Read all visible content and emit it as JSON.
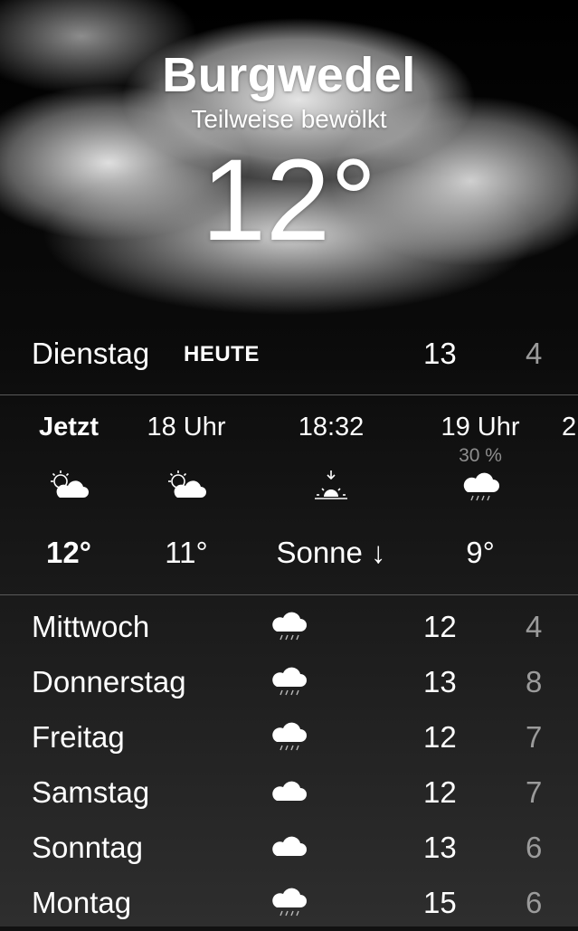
{
  "location": {
    "city": "Burgwedel",
    "condition": "Teilweise bewölkt",
    "temperature": "12°"
  },
  "today": {
    "day": "Dienstag",
    "tag": "HEUTE",
    "high": "13",
    "low": "4"
  },
  "hourly": [
    {
      "time": "Jetzt",
      "pop": "",
      "icon": "partly-cloudy-icon",
      "temp": "12°"
    },
    {
      "time": "18 Uhr",
      "pop": "",
      "icon": "partly-cloudy-icon",
      "temp": "11°"
    },
    {
      "time": "18:32",
      "pop": "",
      "icon": "sunset-icon",
      "temp": "Sonne ↓"
    },
    {
      "time": "19 Uhr",
      "pop": "30 %",
      "icon": "rain-cloud-icon",
      "temp": "9°"
    },
    {
      "time": "2",
      "pop": "",
      "icon": "",
      "temp": ""
    }
  ],
  "daily": [
    {
      "day": "Mittwoch",
      "icon": "rain-cloud-icon",
      "high": "12",
      "low": "4"
    },
    {
      "day": "Donnerstag",
      "icon": "rain-cloud-icon",
      "high": "13",
      "low": "8"
    },
    {
      "day": "Freitag",
      "icon": "rain-cloud-icon",
      "high": "12",
      "low": "7"
    },
    {
      "day": "Samstag",
      "icon": "cloud-icon",
      "high": "12",
      "low": "7"
    },
    {
      "day": "Sonntag",
      "icon": "cloud-icon",
      "high": "13",
      "low": "6"
    },
    {
      "day": "Montag",
      "icon": "rain-cloud-icon",
      "high": "15",
      "low": "6"
    }
  ],
  "colors": {
    "secondary_text": "#9b9b9b",
    "divider": "#5a5a5a"
  }
}
